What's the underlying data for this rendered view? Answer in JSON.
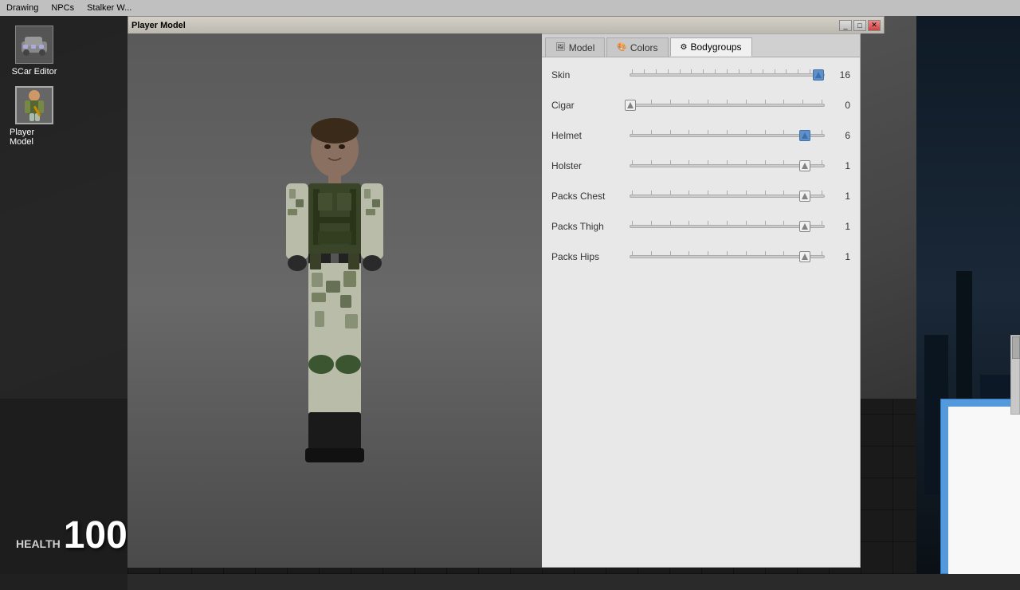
{
  "menuBar": {
    "items": [
      "Drawing",
      "NPCs",
      "Stalker W..."
    ]
  },
  "window": {
    "title": "Player Model",
    "controls": [
      "_",
      "□",
      "✕"
    ]
  },
  "tabs": [
    {
      "id": "model",
      "label": "Model",
      "icon": "🖼",
      "active": false
    },
    {
      "id": "colors",
      "label": "Colors",
      "icon": "🎨",
      "active": false
    },
    {
      "id": "bodygroups",
      "label": "Bodygroups",
      "icon": "⚙",
      "active": true
    }
  ],
  "bodygroups": [
    {
      "name": "Skin",
      "value": 16,
      "maxValue": 16,
      "thumbPercent": 97,
      "isBlue": true
    },
    {
      "name": "Cigar",
      "value": 0,
      "maxValue": 10,
      "thumbPercent": 0,
      "isBlue": false
    },
    {
      "name": "Helmet",
      "value": 6,
      "maxValue": 10,
      "thumbPercent": 90,
      "isBlue": true
    },
    {
      "name": "Holster",
      "value": 1,
      "maxValue": 10,
      "thumbPercent": 90,
      "isBlue": false
    },
    {
      "name": "Packs Chest",
      "value": 1,
      "maxValue": 10,
      "thumbPercent": 90,
      "isBlue": false
    },
    {
      "name": "Packs Thigh",
      "value": 1,
      "maxValue": 10,
      "thumbPercent": 90,
      "isBlue": false
    },
    {
      "name": "Packs Hips",
      "value": 1,
      "maxValue": 10,
      "thumbPercent": 90,
      "isBlue": false
    }
  ],
  "health": {
    "label": "HEALTH",
    "value": "100"
  },
  "sidebar": {
    "items": [
      {
        "id": "scar",
        "label": "SCar Editor",
        "icon": "car"
      },
      {
        "id": "player",
        "label": "Player Model",
        "icon": "person",
        "active": true
      }
    ]
  }
}
